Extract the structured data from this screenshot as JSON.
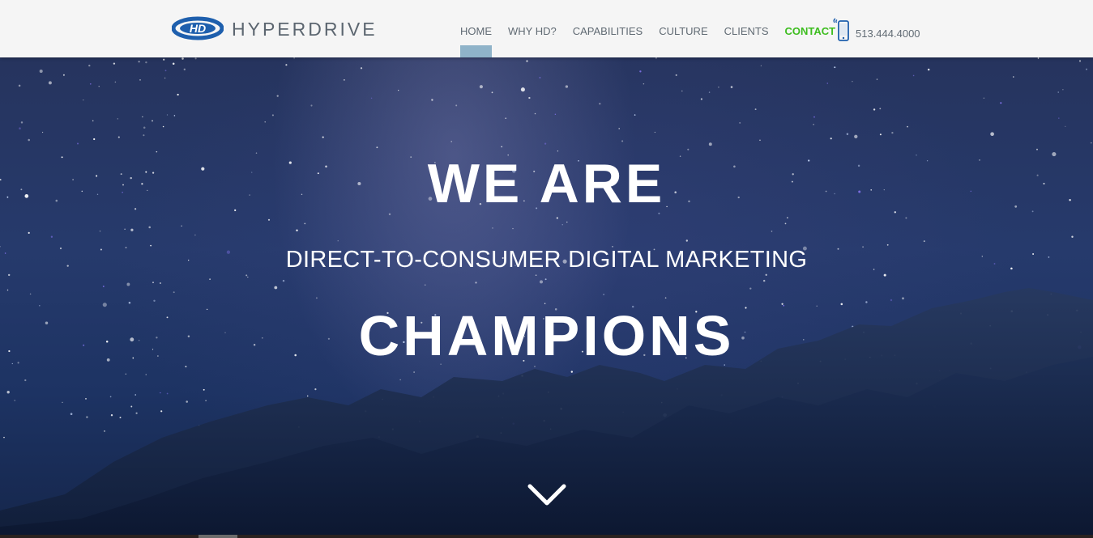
{
  "brand": {
    "logo_mark": "HD",
    "logo_text": "HYPERDRIVE",
    "logo_color": "#1e5fad"
  },
  "nav": {
    "items": [
      {
        "label": "HOME",
        "active": true
      },
      {
        "label": "WHY HD?"
      },
      {
        "label": "CAPABILITIES"
      },
      {
        "label": "CULTURE"
      },
      {
        "label": "CLIENTS"
      },
      {
        "label": "CONTACT",
        "highlight": true
      }
    ],
    "active_color": "#8fb3c9",
    "contact_color": "#3dbd1f"
  },
  "phone": {
    "icon": "mobile-phone-icon",
    "number": "513.444.4000"
  },
  "hero": {
    "line1": "WE ARE",
    "line2": "DIRECT-TO-CONSUMER DIGITAL MARKETING",
    "line3": "CHAMPIONS",
    "scroll_icon": "chevron-down-icon"
  }
}
